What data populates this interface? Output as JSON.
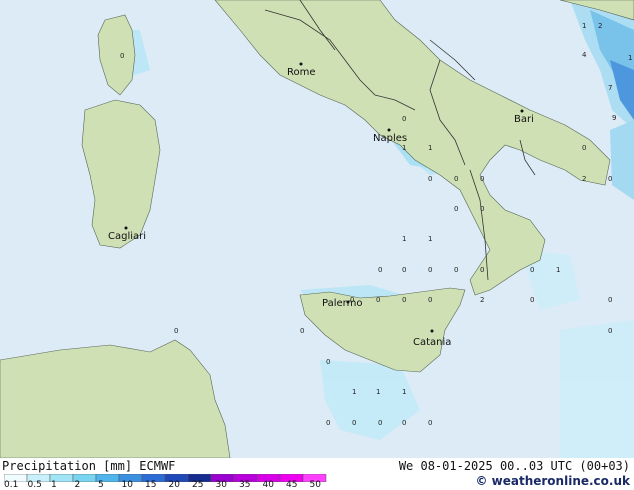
{
  "map": {
    "cities": [
      {
        "name": "Rome"
      },
      {
        "name": "Bari"
      },
      {
        "name": "Naples"
      },
      {
        "name": "Cagliari"
      },
      {
        "name": "Palermo"
      },
      {
        "name": "Catania"
      }
    ],
    "grid_values": [
      "0",
      "1",
      "2",
      "7",
      "9",
      "1",
      "4",
      "0",
      "1",
      "1",
      "0",
      "0",
      "0",
      "0",
      "2",
      "0",
      "0",
      "0",
      "1",
      "1",
      "0",
      "0",
      "0",
      "0",
      "0",
      "0",
      "1",
      "0",
      "0",
      "0",
      "0",
      "2",
      "0",
      "0",
      "0",
      "0",
      "0",
      "0",
      "1",
      "1",
      "1",
      "0",
      "0",
      "0",
      "0",
      "0"
    ]
  },
  "legend": {
    "title": "Precipitation [mm]  ECMWF",
    "datetime": "We 08-01-2025 00..03 UTC (00+03)",
    "credit": "© weatheronline.co.uk",
    "ticks": [
      "0.1",
      "0.5",
      "1",
      "2",
      "5",
      "10",
      "15",
      "20",
      "25",
      "30",
      "35",
      "40",
      "45",
      "50"
    ],
    "colors": [
      "#f0fbff",
      "#c8f0fb",
      "#a0e4f6",
      "#78d4f0",
      "#4fb5ea",
      "#3b8fe0",
      "#2c6cd4",
      "#1f48b8",
      "#162c90",
      "#9a00d0",
      "#b800dc",
      "#d800e8",
      "#ee00f0",
      "#ff40ff"
    ]
  }
}
